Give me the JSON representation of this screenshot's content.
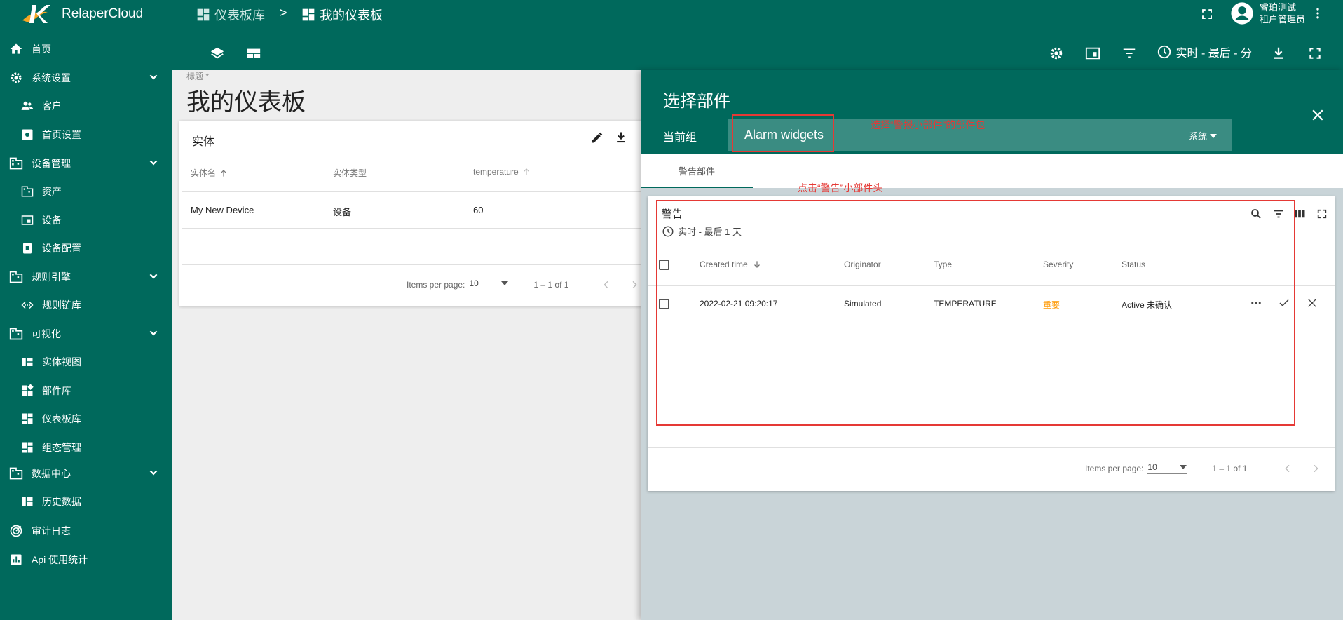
{
  "brand": {
    "name": "RelaperCloud"
  },
  "colors": {
    "primary": "#00695c",
    "primary_light": "#3a8c82",
    "annotation": "#e53935",
    "severity_major": "#ff9800"
  },
  "breadcrumb": {
    "parent": "仪表板库",
    "separator": ">",
    "current": "我的仪表板"
  },
  "user": {
    "name": "睿珀测试",
    "role": "租户管理员"
  },
  "toolbar": {
    "timewindow": "实时 - 最后 - 分"
  },
  "sidebar": {
    "home": "首页",
    "system_settings": "系统设置",
    "customers": "客户",
    "home_settings": "首页设置",
    "device_mgmt": "设备管理",
    "assets": "资产",
    "devices": "设备",
    "device_profiles": "设备配置",
    "rule_engine": "规则引擎",
    "rule_chains": "规则链库",
    "visualization": "可视化",
    "entity_views": "实体视图",
    "widget_library": "部件库",
    "dashboard_library": "仪表板库",
    "scada_mgmt": "组态管理",
    "data_center": "数据中心",
    "history_data": "历史数据",
    "audit_log": "审计日志",
    "api_usage": "Api 使用统计"
  },
  "dashboard": {
    "title_label": "标题 *",
    "title": "我的仪表板",
    "entity_widget": {
      "title": "实体",
      "columns": [
        "实体名",
        "实体类型",
        "temperature"
      ],
      "rows": [
        {
          "name": "My New Device",
          "type": "设备",
          "temperature": "60"
        }
      ],
      "items_per_page_label": "Items per page:",
      "items_per_page": "10",
      "range": "1 – 1 of 1"
    }
  },
  "drawer": {
    "title": "选择部件",
    "group_label": "当前组",
    "bundle": "Alarm widgets",
    "bundle_filter": "系统",
    "tab": "警告部件",
    "alarm_widget": {
      "title": "警告",
      "timewindow": "实时 - 最后 1 天",
      "columns": [
        "Created time",
        "Originator",
        "Type",
        "Severity",
        "Status"
      ],
      "rows": [
        {
          "created_time": "2022-02-21 09:20:17",
          "originator": "Simulated",
          "type": "TEMPERATURE",
          "severity": "重要",
          "status": "Active 未确认"
        }
      ],
      "items_per_page_label": "Items per page:",
      "items_per_page": "10",
      "range": "1 – 1 of 1"
    }
  },
  "annotations": {
    "select_bundle": "选择“警报小部件”的部件包",
    "click_header": "点击“警告”小部件头"
  }
}
